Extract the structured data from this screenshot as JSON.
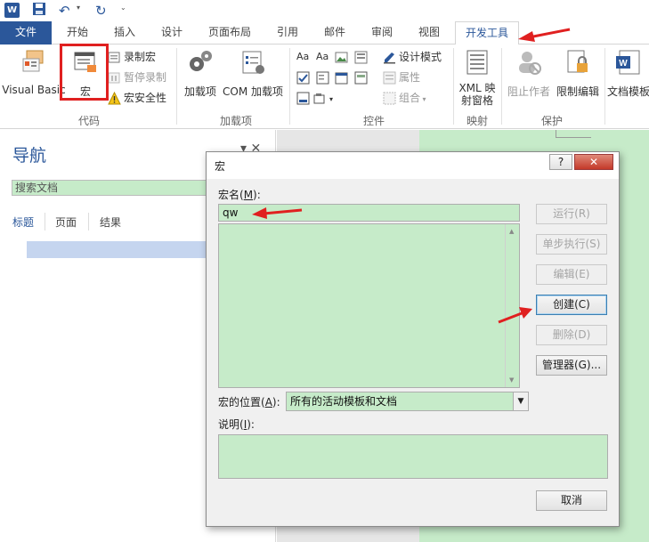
{
  "qat": {
    "logo_text": "W",
    "undo_symbol": "↶",
    "redo_symbol": "↻"
  },
  "tabs": [
    {
      "label": "文件"
    },
    {
      "label": "开始"
    },
    {
      "label": "插入"
    },
    {
      "label": "设计"
    },
    {
      "label": "页面布局"
    },
    {
      "label": "引用"
    },
    {
      "label": "邮件"
    },
    {
      "label": "审阅"
    },
    {
      "label": "视图"
    },
    {
      "label": "开发工具"
    }
  ],
  "ribbon": {
    "code": {
      "visual_basic": "Visual Basic",
      "macros": "宏",
      "record_macro": "录制宏",
      "pause_recording": "暂停录制",
      "macro_security": "宏安全性",
      "group_label": "代码"
    },
    "addins": {
      "addins": "加载项",
      "com_addins": "COM 加载项",
      "group_label": "加载项"
    },
    "controls": {
      "design_mode": "设计模式",
      "properties": "属性",
      "group": "组合",
      "group_label": "控件"
    },
    "mapping": {
      "xml_line1": "XML 映",
      "xml_line2": "射窗格",
      "group_label": "映射"
    },
    "protect": {
      "block_authors": "阻止作者",
      "restrict_editing": "限制编辑",
      "group_label": "保护"
    },
    "templates": {
      "doc_template": "文档模板"
    }
  },
  "nav": {
    "title": "导航",
    "close": "▾ ✕",
    "search_placeholder": "搜索文档",
    "tabs": [
      "标题",
      "页面",
      "结果"
    ]
  },
  "dialog": {
    "title": "宏",
    "help": "?",
    "close": "✕",
    "name_label": "宏名(",
    "name_key": "M",
    "name_label_end": "):",
    "name_value": "qw",
    "location_label": "宏的位置(",
    "location_key": "A",
    "location_label_end": "):",
    "location_value": "所有的活动模板和文档",
    "desc_label": "说明(",
    "desc_key": "I",
    "desc_label_end": "):",
    "buttons": {
      "run": "运行(R)",
      "step": "单步执行(S)",
      "edit": "编辑(E)",
      "create": "创建(C)",
      "delete": "删除(D)",
      "organizer": "管理器(G)...",
      "cancel": "取消"
    }
  },
  "colors": {
    "accent": "#2b579a",
    "field_green": "#c6ebc9",
    "annotation_red": "#e02020"
  }
}
